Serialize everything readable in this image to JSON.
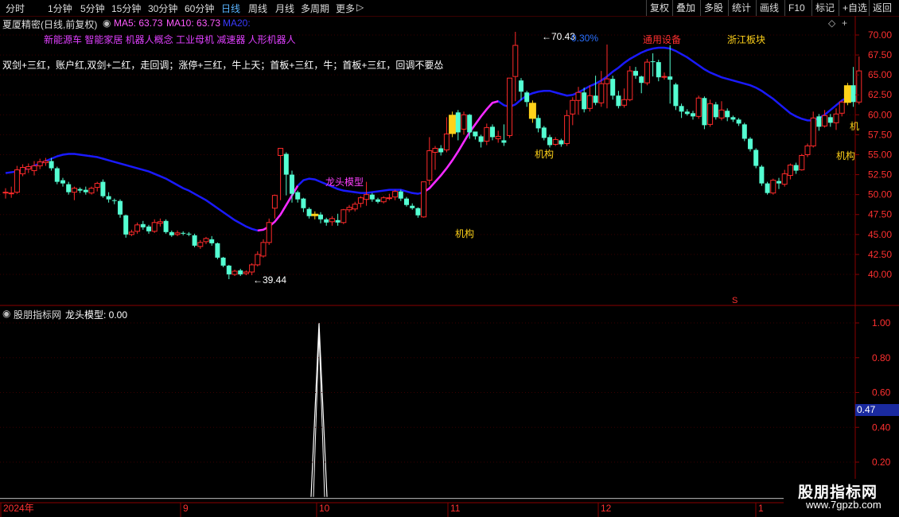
{
  "toolbar": {
    "periods": [
      "分时",
      "1分钟",
      "5分钟",
      "15分钟",
      "30分钟",
      "60分钟",
      "日线",
      "周线",
      "月线",
      "多周期",
      "更多"
    ],
    "active_period": "日线",
    "right_buttons": [
      "复权",
      "叠加",
      "多股",
      "统计",
      "画线",
      "F10",
      "标记",
      "+自选",
      "返回"
    ]
  },
  "stock": {
    "title": "夏厦精密(日线,前复权)",
    "ma5": "MA5: 63.73",
    "ma10": "MA10: 63.73",
    "ma20": "MA20:"
  },
  "concepts_line": "新能源车 智能家居 机器人概念 工业母机 减速器 人形机器人",
  "strategy_line": "双剑+三红，账户红,双剑+二红，走回调；涨停+三红，牛上天；首板+三红，牛；首板+三红，回调不要怂",
  "annotations": {
    "high_label": "70.43",
    "low_label": "39.44",
    "pct_label": "0.30%",
    "equipment_label": "通用设备",
    "zhejiang_label": "浙江板块",
    "dragon_label": "龙头模型",
    "inst_label": "机构",
    "inst_edge_label": "机",
    "s_marker": "S"
  },
  "indicator": {
    "name": "股朋指标网",
    "legend": "龙头模型: 0.00",
    "current_value": "0.47",
    "axis": [
      "1.00",
      "0.80",
      "0.60",
      "0.40",
      "0.20"
    ]
  },
  "price_axis": [
    "70.00",
    "67.50",
    "65.00",
    "62.50",
    "60.00",
    "57.50",
    "55.00",
    "52.50",
    "50.00",
    "47.50",
    "45.00",
    "42.50",
    "40.00"
  ],
  "date_axis": [
    "2024年",
    "9",
    "10",
    "11",
    "12",
    "1"
  ],
  "watermark": {
    "name": "股朋指标网",
    "url": "www.7gpzb.com"
  },
  "colors": {
    "up": "#ff2a2a",
    "down": "#54ffd2",
    "ma_line": "#1a1aff",
    "ma_line_up": "#ff2aff",
    "yellow": "#ffd21a",
    "accent_blue": "#5ab4ff",
    "border": "#8a0000"
  },
  "chart_data": {
    "type": "candlestick",
    "ylim": [
      38,
      72
    ],
    "series": [
      {
        "name": "K",
        "values": [
          [
            50.3,
            50.3,
            49.5,
            50.8
          ],
          [
            50.2,
            50.2,
            49.6,
            51.0
          ],
          [
            50.3,
            53.1,
            50.1,
            53.6
          ],
          [
            52.6,
            53.4,
            52.3,
            53.8
          ],
          [
            53.2,
            53.5,
            52.7,
            53.9
          ],
          [
            53.0,
            53.6,
            52.4,
            54.2
          ],
          [
            53.6,
            54.1,
            53.2,
            54.5
          ],
          [
            54.0,
            54.2,
            53.6,
            54.6
          ],
          [
            54.2,
            53.3,
            53.0,
            54.6
          ],
          [
            53.3,
            51.6,
            51.3,
            53.5
          ],
          [
            51.8,
            51.4,
            51.0,
            52.1
          ],
          [
            51.3,
            50.3,
            50.0,
            51.6
          ],
          [
            50.3,
            50.8,
            49.3,
            51.0
          ],
          [
            50.7,
            50.5,
            50.2,
            50.9
          ],
          [
            50.6,
            50.3,
            50.0,
            51.0
          ],
          [
            50.2,
            50.8,
            50.0,
            51.0
          ],
          [
            50.9,
            51.4,
            50.4,
            51.6
          ],
          [
            51.6,
            49.8,
            49.6,
            51.9
          ],
          [
            49.8,
            49.4,
            49.0,
            50.3
          ],
          [
            49.3,
            49.2,
            48.8,
            49.5
          ],
          [
            49.2,
            47.5,
            47.1,
            49.4
          ],
          [
            47.4,
            45.0,
            44.6,
            47.5
          ],
          [
            45.0,
            45.3,
            44.8,
            45.6
          ],
          [
            45.4,
            46.2,
            45.1,
            46.5
          ],
          [
            46.3,
            45.9,
            45.6,
            46.7
          ],
          [
            46.0,
            45.4,
            45.1,
            46.2
          ],
          [
            45.4,
            46.5,
            45.2,
            46.9
          ],
          [
            46.4,
            46.6,
            46.0,
            47.0
          ],
          [
            46.7,
            45.3,
            45.1,
            46.9
          ],
          [
            45.3,
            44.9,
            44.7,
            45.5
          ],
          [
            45.0,
            45.2,
            44.8,
            45.5
          ],
          [
            45.2,
            45.1,
            44.9,
            45.4
          ],
          [
            45.1,
            45.0,
            44.8,
            45.3
          ],
          [
            44.9,
            43.6,
            43.4,
            45.1
          ],
          [
            43.5,
            44.0,
            43.2,
            44.3
          ],
          [
            44.1,
            44.5,
            43.8,
            44.7
          ],
          [
            44.4,
            43.9,
            43.6,
            44.8
          ],
          [
            43.9,
            42.1,
            41.9,
            44.0
          ],
          [
            42.1,
            41.1,
            40.9,
            42.2
          ],
          [
            41.1,
            40.0,
            39.4,
            41.2
          ],
          [
            40.0,
            40.4,
            39.8,
            40.6
          ],
          [
            40.5,
            40.0,
            39.8,
            40.7
          ],
          [
            40.1,
            40.3,
            39.9,
            40.5
          ],
          [
            40.3,
            41.2,
            39.9,
            41.4
          ],
          [
            41.2,
            42.5,
            41.0,
            42.9
          ],
          [
            42.3,
            44.0,
            42.1,
            44.4
          ],
          [
            44.0,
            46.5,
            43.7,
            47.0
          ],
          [
            48.3,
            49.9,
            47.0,
            50.0
          ],
          [
            54.9,
            55.8,
            49.3,
            55.8
          ],
          [
            55.1,
            52.5,
            49.9,
            55.3
          ],
          [
            52.5,
            50.1,
            49.0,
            53.0
          ],
          [
            50.3,
            49.4,
            49.0,
            50.5
          ],
          [
            49.5,
            48.3,
            47.8,
            49.6
          ],
          [
            48.2,
            47.3,
            47.0,
            48.4
          ],
          [
            47.3,
            47.6,
            46.9,
            47.9
          ],
          [
            47.5,
            46.9,
            46.4,
            47.8
          ],
          [
            46.9,
            46.5,
            46.1,
            47.1
          ],
          [
            46.6,
            47.0,
            46.1,
            47.3
          ],
          [
            46.8,
            46.5,
            46.1,
            47.6
          ],
          [
            46.5,
            48.1,
            46.3,
            48.2
          ],
          [
            48.1,
            48.4,
            47.8,
            48.7
          ],
          [
            48.2,
            48.8,
            47.9,
            49.1
          ],
          [
            48.9,
            49.6,
            48.4,
            49.8
          ],
          [
            49.4,
            50.0,
            48.6,
            51.6
          ],
          [
            50.0,
            49.4,
            49.1,
            50.2
          ],
          [
            49.4,
            49.1,
            48.9,
            49.6
          ],
          [
            49.1,
            49.6,
            48.9,
            49.8
          ],
          [
            49.5,
            49.6,
            49.3,
            50.1
          ],
          [
            49.7,
            50.4,
            49.3,
            50.6
          ],
          [
            50.4,
            49.5,
            49.2,
            50.6
          ],
          [
            49.5,
            48.7,
            48.5,
            49.7
          ],
          [
            48.6,
            48.3,
            48.1,
            48.9
          ],
          [
            48.3,
            47.4,
            47.1,
            48.4
          ],
          [
            47.2,
            51.6,
            47.1,
            51.6
          ],
          [
            51.8,
            55.5,
            51.2,
            57.2
          ],
          [
            55.3,
            55.8,
            53.1,
            56.1
          ],
          [
            55.8,
            55.3,
            54.9,
            56.2
          ],
          [
            55.6,
            57.6,
            55.3,
            59.7
          ],
          [
            57.6,
            60.0,
            57.2,
            60.4
          ],
          [
            60.3,
            57.8,
            56.8,
            60.6
          ],
          [
            58.2,
            60.0,
            57.5,
            60.4
          ],
          [
            60.0,
            57.8,
            57.0,
            60.1
          ],
          [
            57.9,
            57.3,
            56.9,
            57.6
          ],
          [
            57.3,
            56.6,
            55.9,
            57.5
          ],
          [
            56.7,
            58.4,
            56.2,
            58.9
          ],
          [
            58.5,
            57.2,
            56.8,
            58.8
          ],
          [
            57.0,
            57.3,
            56.5,
            58.0
          ],
          [
            56.8,
            56.5,
            56.1,
            58.8
          ],
          [
            57.4,
            64.6,
            57.1,
            64.6
          ],
          [
            64.8,
            68.7,
            61.7,
            70.4
          ],
          [
            64.3,
            62.9,
            61.8,
            64.6
          ],
          [
            62.8,
            61.6,
            61.0,
            63.0
          ],
          [
            61.5,
            59.5,
            59.0,
            61.8
          ],
          [
            59.6,
            58.3,
            57.8,
            60.0
          ],
          [
            58.4,
            57.1,
            56.8,
            58.6
          ],
          [
            57.2,
            56.2,
            55.9,
            57.5
          ],
          [
            56.3,
            56.9,
            56.1,
            57.2
          ],
          [
            56.8,
            56.3,
            56.0,
            57.0
          ],
          [
            56.4,
            59.9,
            56.1,
            60.6
          ],
          [
            60.1,
            61.8,
            58.7,
            62.2
          ],
          [
            61.8,
            62.8,
            60.0,
            63.5
          ],
          [
            62.8,
            60.7,
            60.3,
            63.4
          ],
          [
            60.8,
            62.4,
            60.4,
            63.7
          ],
          [
            62.4,
            61.5,
            61.2,
            64.9
          ],
          [
            61.5,
            63.9,
            61.0,
            65.5
          ],
          [
            63.9,
            64.5,
            60.8,
            68.8
          ],
          [
            64.5,
            62.4,
            61.9,
            64.9
          ],
          [
            62.4,
            61.1,
            60.8,
            63.0
          ],
          [
            61.2,
            61.9,
            60.9,
            63.3
          ],
          [
            61.9,
            65.5,
            61.7,
            66.1
          ],
          [
            65.5,
            64.9,
            64.5,
            66.0
          ],
          [
            64.8,
            64.0,
            62.7,
            64.9
          ],
          [
            64.0,
            66.6,
            63.7,
            67.0
          ],
          [
            66.7,
            66.6,
            64.8,
            67.7
          ],
          [
            66.6,
            64.7,
            64.2,
            66.9
          ],
          [
            64.8,
            64.8,
            64.4,
            65.3
          ],
          [
            64.8,
            64.4,
            61.4,
            68.7
          ],
          [
            63.8,
            61.1,
            60.6,
            64.0
          ],
          [
            61.1,
            60.4,
            59.6,
            61.4
          ],
          [
            60.4,
            60.1,
            59.9,
            60.7
          ],
          [
            60.2,
            59.8,
            59.4,
            60.5
          ],
          [
            59.8,
            62.1,
            59.5,
            62.4
          ],
          [
            62.1,
            58.7,
            58.2,
            62.3
          ],
          [
            58.8,
            61.4,
            58.5,
            61.9
          ],
          [
            61.3,
            59.7,
            59.4,
            61.6
          ],
          [
            59.6,
            60.6,
            59.3,
            61.7
          ],
          [
            60.5,
            59.7,
            59.2,
            60.8
          ],
          [
            59.7,
            59.4,
            59.1,
            59.9
          ],
          [
            59.4,
            58.9,
            58.6,
            59.6
          ],
          [
            58.8,
            57.0,
            56.7,
            59.0
          ],
          [
            57.0,
            55.7,
            55.4,
            57.2
          ],
          [
            55.6,
            53.6,
            53.3,
            55.8
          ],
          [
            53.5,
            51.4,
            51.1,
            53.7
          ],
          [
            51.4,
            50.2,
            50.0,
            51.6
          ],
          [
            50.2,
            51.8,
            50.0,
            52.0
          ],
          [
            51.7,
            51.4,
            50.7,
            52.1
          ],
          [
            51.3,
            52.6,
            51.0,
            53.1
          ],
          [
            52.4,
            53.7,
            51.9,
            53.9
          ],
          [
            53.7,
            53.0,
            52.6,
            54.0
          ],
          [
            53.1,
            54.9,
            53.0,
            55.1
          ],
          [
            55.0,
            56.1,
            54.7,
            56.4
          ],
          [
            56.1,
            59.6,
            55.9,
            60.4
          ],
          [
            59.8,
            58.5,
            58.0,
            60.1
          ],
          [
            58.6,
            59.9,
            58.4,
            60.6
          ],
          [
            59.7,
            59.0,
            58.5,
            60.1
          ],
          [
            59.0,
            60.1,
            58.1,
            60.8
          ],
          [
            60.2,
            61.6,
            59.8,
            61.8
          ],
          [
            61.5,
            63.7,
            61.2,
            64.0
          ],
          [
            63.7,
            61.6,
            61.0,
            66.0
          ],
          [
            61.6,
            65.5,
            61.3,
            67.3
          ]
        ]
      },
      {
        "name": "MA",
        "values": [
          52.7,
          52.8,
          52.9,
          53.1,
          53.3,
          53.6,
          53.9,
          54.2,
          54.5,
          54.8,
          55.0,
          55.1,
          55.1,
          55.0,
          54.9,
          54.8,
          54.7,
          54.5,
          54.3,
          54.1,
          53.9,
          53.7,
          53.5,
          53.3,
          53.1,
          52.9,
          52.6,
          52.3,
          52.0,
          51.6,
          51.2,
          50.8,
          50.5,
          50.1,
          49.7,
          49.3,
          48.8,
          48.3,
          47.8,
          47.3,
          46.8,
          46.4,
          46.0,
          45.7,
          45.5,
          45.6,
          46.0,
          46.6,
          47.5,
          48.7,
          49.9,
          51.1,
          51.8,
          52.0,
          51.9,
          51.6,
          51.3,
          51.0,
          50.7,
          50.5,
          50.4,
          50.3,
          50.2,
          50.2,
          50.3,
          50.4,
          50.5,
          50.6,
          50.6,
          50.6,
          50.4,
          50.2,
          50.1,
          50.3,
          50.8,
          51.6,
          52.4,
          53.3,
          54.3,
          55.4,
          56.6,
          57.8,
          58.8,
          59.8,
          60.7,
          61.5,
          61.7,
          61.2,
          61.0,
          61.3,
          61.9,
          62.4,
          62.7,
          62.9,
          63.0,
          63.0,
          62.8,
          62.6,
          62.4,
          62.5,
          62.8,
          63.2,
          63.6,
          63.9,
          64.3,
          64.8,
          65.4,
          65.9,
          66.5,
          67.0,
          67.4,
          67.8,
          68.1,
          68.3,
          68.4,
          68.4,
          68.3,
          68.0,
          67.6,
          67.2,
          66.7,
          66.2,
          65.7,
          65.3,
          65.0,
          64.7,
          64.5,
          64.3,
          64.1,
          63.9,
          63.7,
          63.4,
          63.0,
          62.5,
          62.0,
          61.4,
          60.8,
          60.2,
          59.8,
          59.5,
          59.3,
          59.3,
          59.6,
          60.0,
          60.6,
          61.2,
          61.8,
          62.2,
          62.5
        ]
      },
      {
        "name": "龙头模型",
        "values": [
          0.47
        ]
      }
    ]
  }
}
